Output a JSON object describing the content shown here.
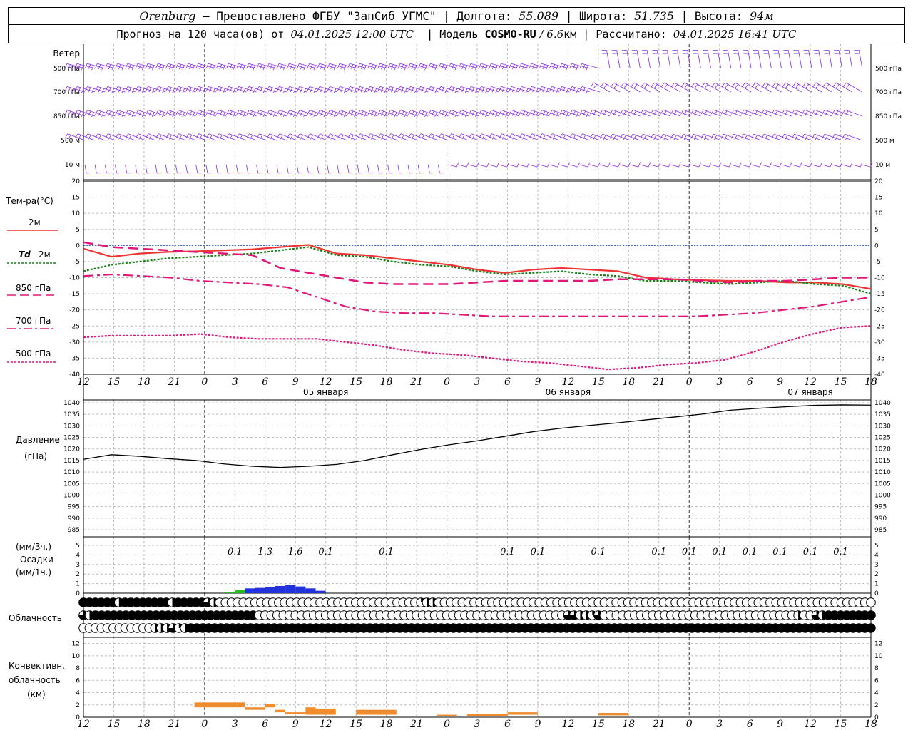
{
  "header": {
    "station": "Orenburg",
    "provider_text": " — Предоставлено ФГБУ \"ЗапСиб УГМС\" | ",
    "lon_label": "Долгота: ",
    "lon": "55.089",
    "lat_label": " | Широта: ",
    "lat": "51.735",
    "alt_label": " | Высота: ",
    "alt": "94м",
    "forecast_prefix": "Прогноз на 120 часа(ов) от ",
    "forecast_time": "04.01.2025 12:00 UTC",
    "model_prefix": "  | Модель ",
    "model": "COSMO-RU",
    "model_res": " / 6.6",
    "model_res_unit": "км",
    "calc_prefix": " | Рассчитано: ",
    "calc_time": "04.01.2025 16:41 UTC"
  },
  "labels": {
    "wind_title": "Ветер",
    "wind_levels": [
      "500 гПа",
      "700 гПа",
      "850 гПа",
      "500 м",
      "10  м"
    ],
    "temp_title": "Тем-ра(°С)",
    "legend_2m": "2м",
    "legend_td_a": "Td",
    "legend_td_b": "2м",
    "legend_850": "850 гПа",
    "legend_700": "700 гПа",
    "legend_500": "500 гПа",
    "pressure_title": "Давление",
    "pressure_unit": "(гПа)",
    "precip_unit3": "(мм/3ч.)",
    "precip_title": "Осадки",
    "precip_unit1": "(мм/1ч.)",
    "cloud_title": "Облачность",
    "conv_title_1": "Конвективн.",
    "conv_title_2": "облачность",
    "conv_unit": "(км)"
  },
  "colors": {
    "temp_2m": "#ee3333",
    "dewpoint_2m": "#1a7f1a",
    "t850": "#e0187a",
    "t700": "#e0187a",
    "t500": "#e0187a",
    "wind_barbs": "#8a2be2",
    "precip_blue": "#2233dd",
    "precip_green": "#22bb22",
    "conv_cloud": "#f08c2c",
    "zero_line": "#3366cc"
  },
  "chart_data": {
    "type": "line",
    "x_hours_utc": [
      12,
      15,
      18,
      21,
      0,
      3,
      6,
      9,
      12,
      15,
      18,
      21,
      0,
      3,
      6,
      9,
      12,
      15,
      18,
      21,
      0,
      3,
      6,
      9,
      12,
      15,
      18
    ],
    "x_dates": [
      {
        "hour_index": 8,
        "label": "05 января"
      },
      {
        "hour_index": 16,
        "label": "06 января"
      },
      {
        "hour_index": 24,
        "label": "07 января"
      }
    ],
    "wind_panel": {
      "levels": [
        "500 гПа",
        "700 гПа",
        "850 гПа",
        "500 м",
        "10  м"
      ]
    },
    "temperature": {
      "ylim": [
        -40,
        20
      ],
      "yticks": [
        20,
        15,
        10,
        5,
        0,
        -5,
        -10,
        -15,
        -20,
        -25,
        -30,
        -35,
        -40
      ],
      "series": [
        {
          "name": "2м",
          "values": [
            -1,
            -3.5,
            -2.5,
            -2,
            -1.8,
            -1.5,
            -1.2,
            -0.5,
            0.2,
            -2.5,
            -3,
            -4,
            -5,
            -6,
            -7.5,
            -8.5,
            -7.5,
            -7,
            -7.5,
            -8,
            -10,
            -10.5,
            -10.8,
            -11,
            -11,
            -11.5,
            -11.5,
            -12,
            -13.5
          ]
        },
        {
          "name": "Td 2м",
          "values": [
            -8,
            -6,
            -5,
            -4,
            -3.5,
            -3,
            -2.5,
            -1.5,
            -0.5,
            -3,
            -3.5,
            -5,
            -6,
            -6.5,
            -8,
            -9,
            -8.5,
            -8,
            -9,
            -9.5,
            -11,
            -11,
            -11.5,
            -12,
            -11.5,
            -11,
            -12,
            -12.5,
            -15
          ]
        },
        {
          "name": "850 гПа",
          "values": [
            1,
            -0.5,
            -1,
            -1.5,
            -2,
            -2.5,
            -3,
            -7,
            -8.5,
            -10,
            -11.5,
            -12,
            -12,
            -12,
            -11.5,
            -11,
            -11,
            -11,
            -11,
            -10.5,
            -10.5,
            -10.5,
            -11,
            -11.5,
            -11,
            -11,
            -10.5,
            -10,
            -10
          ]
        },
        {
          "name": "700 гПа",
          "values": [
            -9.5,
            -9,
            -9.5,
            -10,
            -11,
            -11.5,
            -12,
            -13,
            -16,
            -19,
            -20.5,
            -21,
            -21,
            -21.5,
            -22,
            -22,
            -22,
            -22,
            -22,
            -22,
            -22,
            -22,
            -21.5,
            -21,
            -20,
            -19,
            -17.5,
            -16
          ]
        },
        {
          "name": "500 гПа",
          "values": [
            -28.5,
            -28,
            -28,
            -28,
            -27.5,
            -28.5,
            -29,
            -29,
            -29,
            -30,
            -31,
            -32.5,
            -33.5,
            -34,
            -35,
            -36,
            -36.5,
            -37.5,
            -38.5,
            -38,
            -37,
            -36.5,
            -35.5,
            -33,
            -30,
            -27.5,
            -25.5,
            -25
          ]
        }
      ]
    },
    "pressure": {
      "ylim": [
        985,
        1040
      ],
      "yticks": [
        1040,
        1035,
        1030,
        1025,
        1020,
        1015,
        1010,
        1005,
        1000,
        995,
        990,
        985
      ],
      "values": [
        1015.5,
        1017.5,
        1016.8,
        1015.8,
        1015,
        1013.5,
        1012.5,
        1012,
        1012.5,
        1013.3,
        1015,
        1017.5,
        1019.8,
        1021.8,
        1023.5,
        1025.5,
        1027.5,
        1029,
        1030.2,
        1031.3,
        1032.6,
        1033.8,
        1035.1,
        1036.8,
        1037.6,
        1038.3,
        1038.9,
        1039.1,
        1039
      ]
    },
    "precipitation": {
      "ylim": [
        0,
        5
      ],
      "yticks": [
        5,
        4,
        3,
        2,
        1,
        0
      ],
      "labels_3h": [
        {
          "hour_offset": 15,
          "value": "0.1"
        },
        {
          "hour_offset": 18,
          "value": "1.3"
        },
        {
          "hour_offset": 21,
          "value": "1.6"
        },
        {
          "hour_offset": 24,
          "value": "0.1"
        },
        {
          "hour_offset": 30,
          "value": "0.1"
        },
        {
          "hour_offset": 42,
          "value": "0.1"
        },
        {
          "hour_offset": 45,
          "value": "0.1"
        },
        {
          "hour_offset": 51,
          "value": "0.1"
        },
        {
          "hour_offset": 57,
          "value": "0.1"
        },
        {
          "hour_offset": 60,
          "value": "0.1"
        },
        {
          "hour_offset": 63,
          "value": "0.1"
        },
        {
          "hour_offset": 66,
          "value": "0.1"
        },
        {
          "hour_offset": 69,
          "value": "0.1"
        },
        {
          "hour_offset": 72,
          "value": "0.1"
        },
        {
          "hour_offset": 75,
          "value": "0.1"
        }
      ],
      "hourly_bars": [
        {
          "hour_offset": 14,
          "value": 0.1,
          "kind": "snow"
        },
        {
          "hour_offset": 15,
          "value": 0.3,
          "kind": "snow"
        },
        {
          "hour_offset": 16,
          "value": 0.5,
          "kind": "rain"
        },
        {
          "hour_offset": 17,
          "value": 0.55,
          "kind": "rain"
        },
        {
          "hour_offset": 18,
          "value": 0.6,
          "kind": "rain"
        },
        {
          "hour_offset": 19,
          "value": 0.75,
          "kind": "rain"
        },
        {
          "hour_offset": 20,
          "value": 0.85,
          "kind": "rain"
        },
        {
          "hour_offset": 21,
          "value": 0.7,
          "kind": "rain"
        },
        {
          "hour_offset": 22,
          "value": 0.5,
          "kind": "rain"
        },
        {
          "hour_offset": 23,
          "value": 0.25,
          "kind": "rain"
        }
      ]
    },
    "cloudiness": {
      "rows": [
        "upper",
        "middle",
        "lower"
      ],
      "levels": [
        [
          4,
          4,
          4,
          4,
          4,
          4,
          2,
          4,
          4,
          4,
          4,
          4,
          4,
          4,
          4,
          2,
          4,
          4,
          4,
          4,
          4,
          3,
          2,
          0,
          0,
          0,
          0,
          0,
          0,
          0,
          0,
          0,
          0,
          0,
          0,
          0,
          0,
          0,
          0,
          0,
          0,
          0,
          0,
          0,
          0,
          0,
          0,
          0,
          0,
          0,
          0,
          0,
          0,
          0,
          0,
          0,
          0,
          1,
          2,
          2,
          0,
          0,
          0,
          0,
          0,
          0,
          0,
          0,
          0,
          0,
          0,
          0,
          0,
          0,
          0,
          0,
          0,
          0,
          0,
          0,
          0,
          0,
          0,
          0,
          0,
          0,
          0,
          0,
          0,
          0,
          0,
          0,
          0,
          0,
          0,
          0,
          0,
          0,
          0,
          0,
          0,
          0,
          0,
          0,
          0,
          0,
          0,
          0,
          0,
          0,
          0,
          0,
          0,
          0,
          0,
          0,
          0,
          0,
          0,
          0,
          0,
          0,
          0,
          0,
          0,
          0,
          0,
          0,
          0,
          0,
          0,
          0,
          0,
          0
        ],
        [
          3,
          2,
          4,
          4,
          4,
          4,
          4,
          4,
          4,
          4,
          4,
          4,
          4,
          4,
          4,
          4,
          4,
          4,
          4,
          4,
          4,
          4,
          4,
          4,
          4,
          4,
          4,
          4,
          4,
          0,
          0,
          0,
          0,
          0,
          0,
          0,
          0,
          0,
          0,
          0,
          0,
          0,
          0,
          0,
          0,
          0,
          0,
          0,
          0,
          0,
          0,
          0,
          0,
          0,
          0,
          0,
          0,
          0,
          0,
          0,
          0,
          0,
          0,
          0,
          0,
          0,
          0,
          0,
          0,
          0,
          0,
          0,
          0,
          0,
          0,
          0,
          0,
          0,
          0,
          0,
          3,
          3,
          2,
          2,
          1,
          3,
          0,
          0,
          0,
          0,
          0,
          0,
          0,
          0,
          0,
          0,
          0,
          0,
          0,
          0,
          0,
          0,
          0,
          0,
          0,
          0,
          0,
          0,
          0,
          0,
          0,
          0,
          0,
          0,
          0,
          0,
          0,
          0,
          2,
          0,
          0,
          3,
          2,
          4,
          4,
          4,
          4,
          4,
          4,
          4,
          4
        ],
        [
          0,
          0,
          0,
          0,
          0,
          0,
          0,
          0,
          0,
          0,
          0,
          0,
          2,
          2,
          2,
          3,
          1,
          2,
          4,
          4,
          4,
          4,
          4,
          4,
          4,
          4,
          4,
          4,
          4,
          4,
          4,
          4,
          4,
          4,
          4,
          4,
          4,
          4,
          4,
          4,
          4,
          4,
          4,
          4,
          4,
          4,
          4,
          4,
          4,
          4,
          4,
          4,
          4,
          4,
          4,
          4,
          4,
          4,
          4,
          4,
          4,
          4,
          4,
          4,
          4,
          4,
          4,
          4,
          4,
          4,
          4,
          4,
          4,
          4,
          4,
          4,
          4,
          4,
          4,
          4,
          4,
          4,
          4,
          4,
          4,
          4,
          4,
          4,
          4,
          4,
          4,
          4,
          4,
          4,
          4,
          4,
          4,
          4,
          4,
          4,
          4,
          4,
          4,
          4,
          4,
          4,
          4,
          4,
          4,
          4,
          4,
          4,
          4,
          4,
          4,
          4,
          4,
          4,
          4,
          4,
          4,
          4,
          4,
          4,
          4,
          4,
          4,
          4,
          4,
          4,
          4,
          4,
          4
        ]
      ]
    },
    "convective_cloud": {
      "ylim": [
        0,
        13
      ],
      "yticks": [
        12,
        10,
        8,
        6,
        4,
        2,
        0
      ],
      "segments_km": [
        {
          "from_h": 11,
          "to_h": 16,
          "base": 1.6,
          "top": 2.4
        },
        {
          "from_h": 16,
          "to_h": 18,
          "base": 1.2,
          "top": 1.6
        },
        {
          "from_h": 18,
          "to_h": 19,
          "base": 1.6,
          "top": 2.2
        },
        {
          "from_h": 19,
          "to_h": 20,
          "base": 0.8,
          "top": 1.2
        },
        {
          "from_h": 20,
          "to_h": 22,
          "base": 0.5,
          "top": 0.8
        },
        {
          "from_h": 22,
          "to_h": 23,
          "base": 0.4,
          "top": 1.6
        },
        {
          "from_h": 23,
          "to_h": 25,
          "base": 0.4,
          "top": 1.4
        },
        {
          "from_h": 27,
          "to_h": 31,
          "base": 0.4,
          "top": 1.2
        },
        {
          "from_h": 35,
          "to_h": 37,
          "base": 0.2,
          "top": 0.4
        },
        {
          "from_h": 38,
          "to_h": 42,
          "base": 0.2,
          "top": 0.5
        },
        {
          "from_h": 42,
          "to_h": 45,
          "base": 0.4,
          "top": 0.8
        },
        {
          "from_h": 51,
          "to_h": 54,
          "base": 0.3,
          "top": 0.7
        }
      ]
    }
  }
}
